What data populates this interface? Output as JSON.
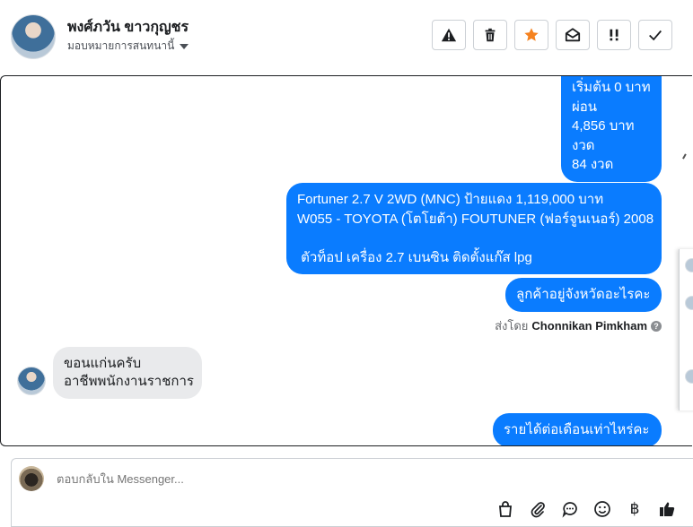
{
  "header": {
    "contact_name": "พงศ์ภวัน ขาวกุญชร",
    "assign_label": "มอบหมายการสนทนานี้",
    "actions": [
      {
        "name": "spam",
        "icon": "warning-icon"
      },
      {
        "name": "delete",
        "icon": "trash-icon"
      },
      {
        "name": "star",
        "icon": "star-icon",
        "color": "#f5821f"
      },
      {
        "name": "mark-unread",
        "icon": "envelope-open-icon"
      },
      {
        "name": "follow-up",
        "icon": "exclamation-icon"
      },
      {
        "name": "done",
        "icon": "check-icon"
      }
    ]
  },
  "messages": {
    "m1": [
      "เริ่มต้น 0 บาท",
      "ผ่อน",
      "4,856 บาท",
      "งวด",
      "84 งวด"
    ],
    "m2": [
      "Fortuner 2.7 V 2WD (MNC) ป้ายแดง 1,119,000 บาท",
      "W055 - TOYOTA (โตโยต้า) FOUTUNER (ฟอร์จูนเนอร์) 2008",
      "",
      " ตัวท็อป เครื่อง 2.7 เบนซิน ติดตั้งแก๊ส lpg"
    ],
    "m3": "ลูกค้าอยู่จังหวัดอะไรคะ",
    "sent_by_prefix": "ส่งโดย",
    "sent_by_name": "Chonnikan Pimkham",
    "help_glyph": "?",
    "m4": [
      "ขอนแก่นครับ",
      "อาชีพพนักงานราชการ"
    ],
    "m5": "รายได้ต่อเดือนเท่าไหร่คะ"
  },
  "composer": {
    "placeholder": "ตอบกลับใน Messenger...",
    "tools": [
      "shopping-bag-icon",
      "paperclip-icon",
      "saved-reply-icon",
      "emoji-icon",
      "baht-icon",
      "thumbs-up-icon"
    ],
    "baht_glyph": "฿"
  },
  "colors": {
    "outgoing_bubble": "#0a7cff",
    "incoming_bubble": "#e9eaec",
    "star": "#f5821f"
  }
}
